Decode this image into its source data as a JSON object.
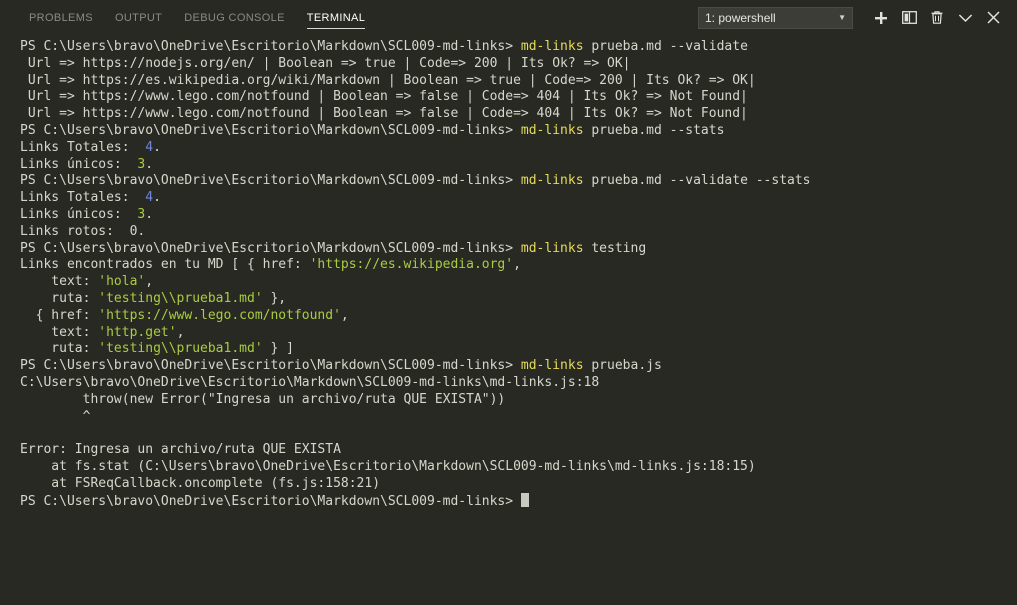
{
  "panel": {
    "tabs": [
      {
        "label": "PROBLEMS",
        "active": false
      },
      {
        "label": "OUTPUT",
        "active": false
      },
      {
        "label": "DEBUG CONSOLE",
        "active": false
      },
      {
        "label": "TERMINAL",
        "active": true
      }
    ],
    "terminal_selector": {
      "value": "1: powershell",
      "caret_icon": "chevron-down-icon"
    },
    "actions": [
      {
        "name": "new-terminal-button",
        "icon": "plus-icon",
        "label": "+"
      },
      {
        "name": "split-terminal-button",
        "icon": "split-panel-icon",
        "label": "Split"
      },
      {
        "name": "kill-terminal-button",
        "icon": "trash-icon",
        "label": "Kill"
      },
      {
        "name": "maximize-panel-button",
        "icon": "chevron-down-icon",
        "label": "Maximize"
      },
      {
        "name": "close-panel-button",
        "icon": "close-icon",
        "label": "Close"
      }
    ]
  },
  "colors": {
    "background": "#282923",
    "foreground": "#d6d7cb",
    "command_yellow": "#e6db5a",
    "string_green": "#a9cc42",
    "number_blue": "#7186e0",
    "tab_active": "#ffffff",
    "tab_inactive": "#8a8a82",
    "select_background": "#3c3d37"
  },
  "terminal": {
    "prompt_prefix": "PS C:\\Users\\bravo\\OneDrive\\Escritorio\\Markdown\\SCL009-md-links> ",
    "cursor": "block",
    "lines": [
      {
        "type": "prompt",
        "prompt": "PS C:\\Users\\bravo\\OneDrive\\Escritorio\\Markdown\\SCL009-md-links> ",
        "cmd": "md-links",
        "args": " prueba.md --validate"
      },
      {
        "type": "plain",
        "text": " Url => https://nodejs.org/en/ | Boolean => true | Code=> 200 | Its Ok? => OK|"
      },
      {
        "type": "plain",
        "text": " Url => https://es.wikipedia.org/wiki/Markdown | Boolean => true | Code=> 200 | Its Ok? => OK|"
      },
      {
        "type": "plain",
        "text": " Url => https://www.lego.com/notfound | Boolean => false | Code=> 404 | Its Ok? => Not Found|"
      },
      {
        "type": "plain",
        "text": " Url => https://www.lego.com/notfound | Boolean => false | Code=> 404 | Its Ok? => Not Found|"
      },
      {
        "type": "prompt",
        "prompt": "PS C:\\Users\\bravo\\OneDrive\\Escritorio\\Markdown\\SCL009-md-links> ",
        "cmd": "md-links",
        "args": " prueba.md --stats"
      },
      {
        "type": "stat",
        "label": "Links Totales:  ",
        "value": "4",
        "value_color": "blue",
        "suffix": "."
      },
      {
        "type": "stat",
        "label": "Links únicos:  ",
        "value": "3",
        "value_color": "lime",
        "suffix": "."
      },
      {
        "type": "prompt",
        "prompt": "PS C:\\Users\\bravo\\OneDrive\\Escritorio\\Markdown\\SCL009-md-links> ",
        "cmd": "md-links",
        "args": " prueba.md --validate --stats"
      },
      {
        "type": "stat",
        "label": "Links Totales:  ",
        "value": "4",
        "value_color": "blue",
        "suffix": "."
      },
      {
        "type": "stat",
        "label": "Links únicos:  ",
        "value": "3",
        "value_color": "lime",
        "suffix": "."
      },
      {
        "type": "stat",
        "label": "Links rotos:  ",
        "value": "0",
        "value_color": "plain",
        "suffix": "."
      },
      {
        "type": "prompt",
        "prompt": "PS C:\\Users\\bravo\\OneDrive\\Escritorio\\Markdown\\SCL009-md-links> ",
        "cmd": "md-links",
        "args": " testing"
      },
      {
        "type": "obj",
        "pre": "Links encontrados en tu MD [ { href: ",
        "str": "'https://es.wikipedia.org'",
        "post": ","
      },
      {
        "type": "obj",
        "pre": "    text: ",
        "str": "'hola'",
        "post": ","
      },
      {
        "type": "obj",
        "pre": "    ruta: ",
        "str": "'testing\\\\prueba1.md'",
        "post": " },"
      },
      {
        "type": "obj",
        "pre": "  { href: ",
        "str": "'https://www.lego.com/notfound'",
        "post": ","
      },
      {
        "type": "obj",
        "pre": "    text: ",
        "str": "'http.get'",
        "post": ","
      },
      {
        "type": "obj",
        "pre": "    ruta: ",
        "str": "'testing\\\\prueba1.md'",
        "post": " } ]"
      },
      {
        "type": "prompt",
        "prompt": "PS C:\\Users\\bravo\\OneDrive\\Escritorio\\Markdown\\SCL009-md-links> ",
        "cmd": "md-links",
        "args": " prueba.js"
      },
      {
        "type": "plain",
        "text": "C:\\Users\\bravo\\OneDrive\\Escritorio\\Markdown\\SCL009-md-links\\md-links.js:18"
      },
      {
        "type": "plain",
        "text": "        throw(new Error(\"Ingresa un archivo/ruta QUE EXISTA\"))"
      },
      {
        "type": "plain",
        "text": "        ^"
      },
      {
        "type": "plain",
        "text": ""
      },
      {
        "type": "plain",
        "text": "Error: Ingresa un archivo/ruta QUE EXISTA"
      },
      {
        "type": "plain",
        "text": "    at fs.stat (C:\\Users\\bravo\\OneDrive\\Escritorio\\Markdown\\SCL009-md-links\\md-links.js:18:15)"
      },
      {
        "type": "plain",
        "text": "    at FSReqCallback.oncomplete (fs.js:158:21)"
      },
      {
        "type": "cursor-line",
        "prompt": "PS C:\\Users\\bravo\\OneDrive\\Escritorio\\Markdown\\SCL009-md-links> "
      }
    ]
  }
}
